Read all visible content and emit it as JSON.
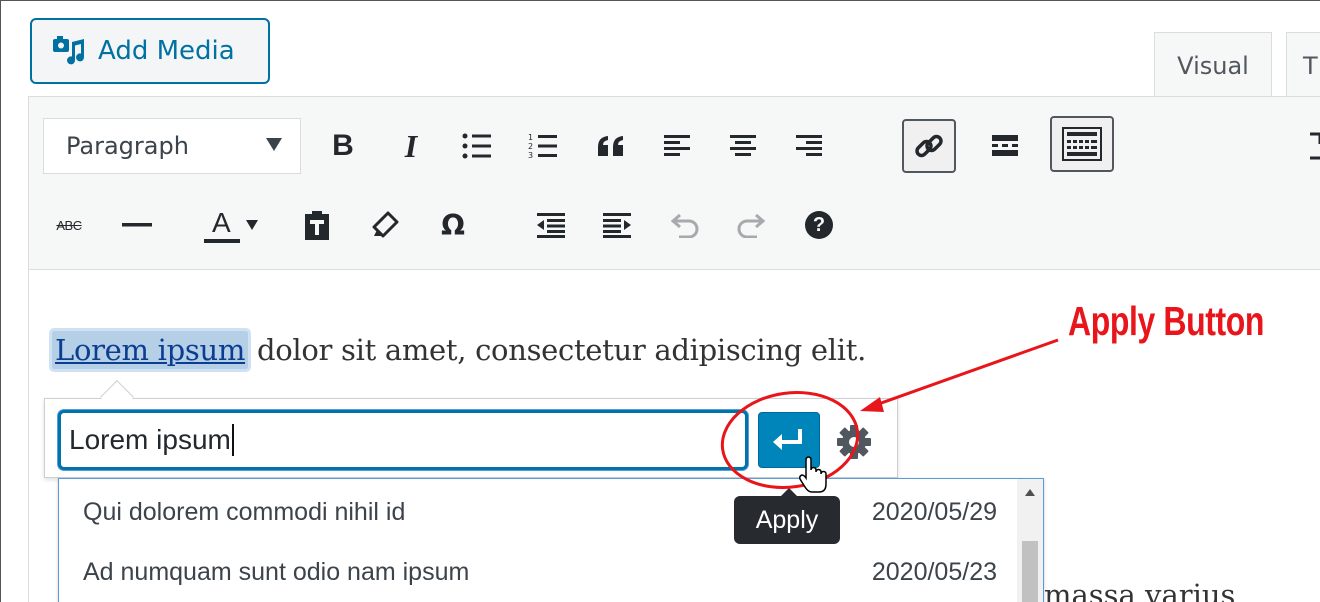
{
  "editor": {
    "add_media_label": "Add Media",
    "tabs": [
      {
        "label": "Visual"
      },
      {
        "label": "T"
      }
    ],
    "format_select": "Paragraph"
  },
  "toolbar_row1_icons": [
    "bold-icon",
    "italic-icon",
    "bulleted-list-icon",
    "numbered-list-icon",
    "blockquote-icon",
    "align-left-icon",
    "align-center-icon",
    "align-right-icon",
    "link-icon",
    "read-more-icon",
    "toolbar-toggle-icon",
    "fullscreen-icon"
  ],
  "toolbar_row2_icons": [
    "strikethrough-icon",
    "horizontal-line-icon",
    "text-color-icon",
    "paste-as-text-icon",
    "clear-formatting-icon",
    "special-character-icon",
    "decrease-indent-icon",
    "increase-indent-icon",
    "undo-icon",
    "redo-icon",
    "help-icon"
  ],
  "toolbar_text": {
    "bold": "B",
    "italic": "I",
    "strike": "ABC",
    "color": "A",
    "omega": "Ω",
    "help": "?"
  },
  "content": {
    "highlighted": "Lorem ipsum",
    "rest": " dolor sit amet, consectetur adipiscing elit.",
    "partial": "massa varius"
  },
  "link_popup": {
    "input_value": "Lorem ipsum",
    "tooltip": "Apply",
    "suggestions": [
      {
        "title": "Qui dolorem commodi nihil id",
        "date": "2020/05/29"
      },
      {
        "title": "Ad numquam sunt odio nam ipsum",
        "date": "2020/05/23"
      }
    ]
  },
  "annotation": {
    "label": "Apply Button",
    "color": "#e8151b"
  },
  "colors": {
    "primary": "#0085ba",
    "accent_blue": "#0073aa",
    "annotation_red": "#e8151b"
  }
}
